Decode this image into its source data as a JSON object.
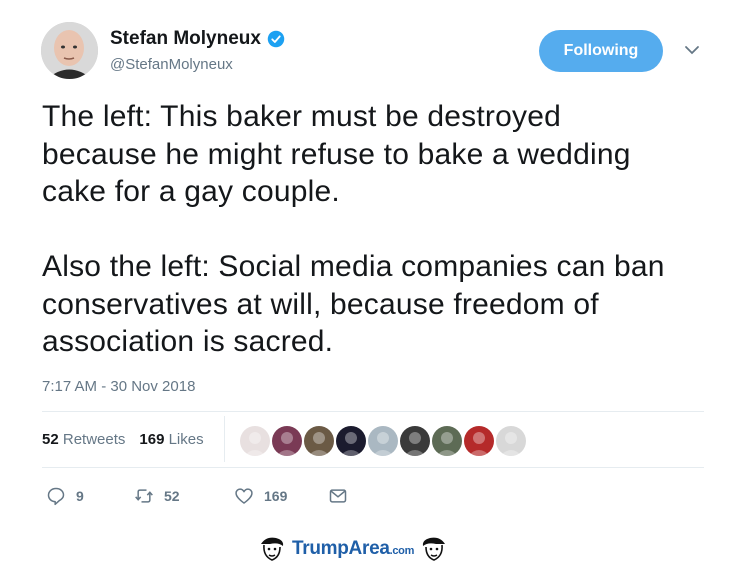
{
  "author": {
    "name": "Stefan Molyneux",
    "handle": "@StefanMolyneux"
  },
  "follow_button": {
    "label": "Following"
  },
  "tweet": {
    "text": "The left: This baker must be destroyed\nbecause he might refuse to bake a wedding\ncake for a gay couple.\n\nAlso the left: Social media companies can ban\nconservatives at will, because freedom of\nassociation is sacred.",
    "timestamp": "7:17 AM - 30 Nov 2018"
  },
  "stats": {
    "retweets_count": "52",
    "retweets_label": "Retweets",
    "likes_count": "169",
    "likes_label": "Likes"
  },
  "likers": [
    {
      "name": "liker-avatar-1",
      "color": "#e8e0e0"
    },
    {
      "name": "liker-avatar-2",
      "color": "#7a3a55"
    },
    {
      "name": "liker-avatar-3",
      "color": "#6b5a45"
    },
    {
      "name": "liker-avatar-4",
      "color": "#1b1b2e"
    },
    {
      "name": "liker-avatar-5",
      "color": "#aab8c2"
    },
    {
      "name": "liker-avatar-6",
      "color": "#3a3a3a"
    },
    {
      "name": "liker-avatar-7",
      "color": "#5d6b55"
    },
    {
      "name": "liker-avatar-8",
      "color": "#b52a2a"
    },
    {
      "name": "liker-avatar-9",
      "color": "#d8d8d8"
    }
  ],
  "actions": {
    "reply_count": "9",
    "retweet_count": "52",
    "like_count": "169"
  },
  "footer": {
    "brand": "TrumpArea",
    "suffix": ".com"
  },
  "colors": {
    "accent": "#55acee",
    "muted": "#657786",
    "text": "#14171a"
  }
}
